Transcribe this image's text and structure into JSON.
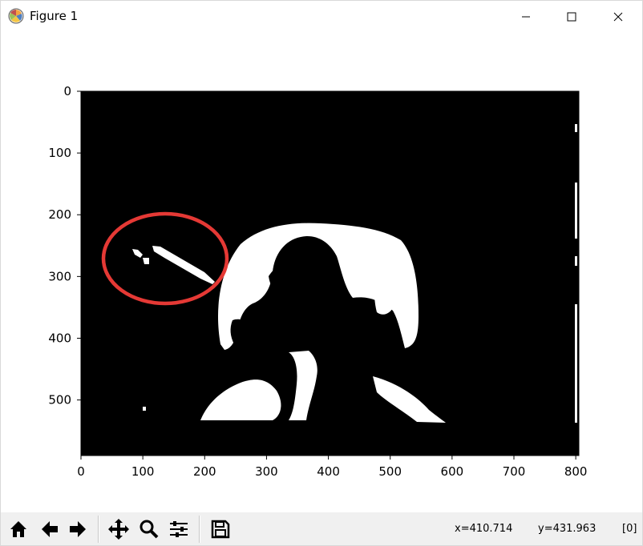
{
  "window": {
    "title": "Figure 1",
    "icon": "matplotlib-logo-icon",
    "controls": [
      "minimize-icon",
      "maximize-icon",
      "close-icon"
    ]
  },
  "axes": {
    "x_ticks": [
      "0",
      "100",
      "200",
      "300",
      "400",
      "500",
      "600",
      "700",
      "800"
    ],
    "y_ticks": [
      "0",
      "100",
      "200",
      "300",
      "400",
      "500"
    ],
    "x_range": [
      0,
      805
    ],
    "y_range": [
      0,
      590
    ],
    "y_inverted": true
  },
  "image": {
    "description_type": "binary-thresholded-image",
    "background_color": "#000000",
    "foreground_color": "#ffffff"
  },
  "annotation": {
    "shape": "ellipse",
    "color": "#e53935"
  },
  "toolbar": {
    "buttons": [
      "home-icon",
      "back-icon",
      "forward-icon",
      "pan-icon",
      "zoom-icon",
      "configure-subplots-icon",
      "save-icon"
    ]
  },
  "status": {
    "x_readout": "x=410.714",
    "y_readout": "y=431.963",
    "value_readout": "[0]"
  }
}
